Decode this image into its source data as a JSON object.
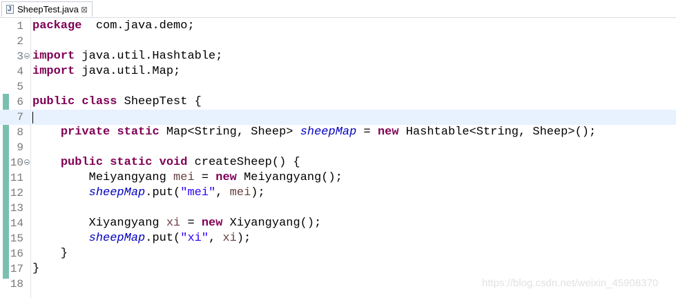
{
  "tab": {
    "label": "SheepTest.java",
    "close_glyph": "⊠",
    "icon": "java-file-icon",
    "icon_glyph": "J"
  },
  "lines": [
    {
      "n": "1",
      "code": [
        [
          "kw",
          "package"
        ],
        [
          "",
          "  com.java.demo;"
        ]
      ]
    },
    {
      "n": "2",
      "code": []
    },
    {
      "n": "3",
      "fold": true,
      "code": [
        [
          "kw",
          "import"
        ],
        [
          "",
          " java.util.Hashtable;"
        ]
      ]
    },
    {
      "n": "4",
      "code": [
        [
          "kw",
          "import"
        ],
        [
          "",
          " java.util.Map;"
        ]
      ]
    },
    {
      "n": "5",
      "code": []
    },
    {
      "n": "6",
      "code": [
        [
          "kw",
          "public"
        ],
        [
          "",
          " "
        ],
        [
          "kw",
          "class"
        ],
        [
          "",
          " SheepTest {"
        ]
      ]
    },
    {
      "n": "7",
      "current": true,
      "code": []
    },
    {
      "n": "8",
      "code": [
        [
          "",
          "    "
        ],
        [
          "kw",
          "private"
        ],
        [
          "",
          " "
        ],
        [
          "kw",
          "static"
        ],
        [
          "",
          " Map<String, Sheep> "
        ],
        [
          "field",
          "sheepMap"
        ],
        [
          "",
          " = "
        ],
        [
          "kw",
          "new"
        ],
        [
          "",
          " Hashtable<String, Sheep>();"
        ]
      ]
    },
    {
      "n": "9",
      "code": []
    },
    {
      "n": "10",
      "fold": true,
      "code": [
        [
          "",
          "    "
        ],
        [
          "kw",
          "public"
        ],
        [
          "",
          " "
        ],
        [
          "kw",
          "static"
        ],
        [
          "",
          " "
        ],
        [
          "kw",
          "void"
        ],
        [
          "",
          " createSheep() {"
        ]
      ]
    },
    {
      "n": "11",
      "code": [
        [
          "",
          "        Meiyangyang "
        ],
        [
          "local",
          "mei"
        ],
        [
          "",
          " = "
        ],
        [
          "kw",
          "new"
        ],
        [
          "",
          " Meiyangyang();"
        ]
      ]
    },
    {
      "n": "12",
      "code": [
        [
          "",
          "        "
        ],
        [
          "field",
          "sheepMap"
        ],
        [
          "",
          ".put("
        ],
        [
          "str",
          "\"mei\""
        ],
        [
          "",
          ", "
        ],
        [
          "local",
          "mei"
        ],
        [
          "",
          ");"
        ]
      ]
    },
    {
      "n": "13",
      "code": []
    },
    {
      "n": "14",
      "code": [
        [
          "",
          "        Xiyangyang "
        ],
        [
          "local",
          "xi"
        ],
        [
          "",
          " = "
        ],
        [
          "kw",
          "new"
        ],
        [
          "",
          " Xiyangyang();"
        ]
      ]
    },
    {
      "n": "15",
      "code": [
        [
          "",
          "        "
        ],
        [
          "field",
          "sheepMap"
        ],
        [
          "",
          ".put("
        ],
        [
          "str",
          "\"xi\""
        ],
        [
          "",
          ", "
        ],
        [
          "local",
          "xi"
        ],
        [
          "",
          ");"
        ]
      ]
    },
    {
      "n": "16",
      "code": [
        [
          "",
          "    }"
        ]
      ]
    },
    {
      "n": "17",
      "code": [
        [
          "",
          "}"
        ]
      ]
    },
    {
      "n": "18",
      "code": []
    }
  ],
  "watermark": "https://blog.csdn.net/weixin_45908370",
  "colors": {
    "keyword": "#7f0055",
    "field": "#0000c0",
    "local": "#6a3e3e",
    "string": "#2a00ff",
    "current_line": "#e8f2fe",
    "change_bar": "#7bbfb0"
  }
}
